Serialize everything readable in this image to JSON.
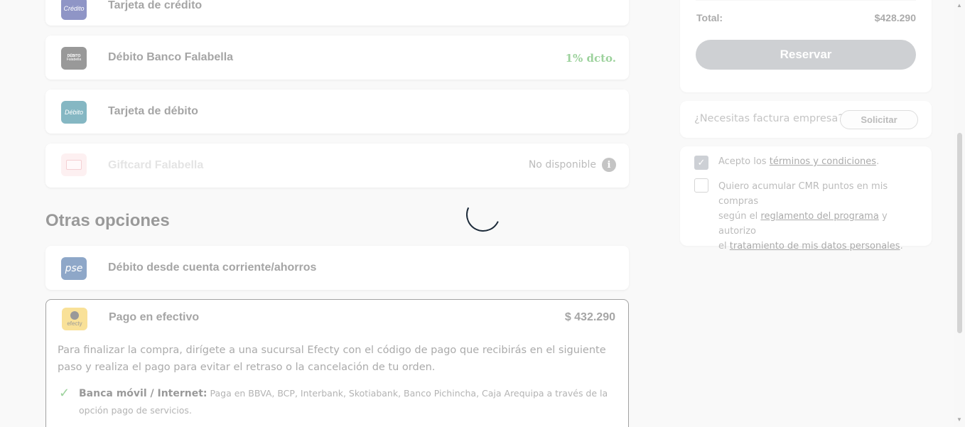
{
  "payment_methods": [
    {
      "label": "Tarjeta de crédito",
      "icon_text": "Crédito"
    },
    {
      "label": "Débito Banco Falabella",
      "icon_text_top": "DÉBITO",
      "icon_text_bottom": "Falabella",
      "badge": "1% dcto."
    },
    {
      "label": "Tarjeta de débito",
      "icon_text": "Débito"
    },
    {
      "label": "Giftcard Falabella",
      "status": "No disponible"
    }
  ],
  "other_options": {
    "title": "Otras opciones",
    "items": [
      {
        "label": "Débito desde cuenta corriente/ahorros",
        "icon_text": "pse"
      },
      {
        "label": "Pago en efectivo",
        "icon_text": "efecty",
        "price": "$ 432.290",
        "description": "Para finalizar la compra, dirígete a una sucursal Efecty con el código de pago que recibirás en el siguiente paso y realiza el pago para evitar el retraso o la cancelación de tu orden.",
        "bullet_title": "Banca móvil / Internet:",
        "bullet_text": "Paga en BBVA, BCP, Interbank, Skotiabank, Banco Pichincha, Caja Arequipa a través de la opción pago de servicios."
      }
    ]
  },
  "summary": {
    "total_label": "Total:",
    "total_value": "$428.290",
    "reserve_button": "Reservar"
  },
  "invoice": {
    "question": "¿Necesitas factura empresa?",
    "button": "Solicitar"
  },
  "terms": {
    "accept_prefix": "Acepto los ",
    "accept_link": "términos y condiciones",
    "accept_suffix": ".",
    "cmr_line1": "Quiero acumular CMR puntos en mis compras",
    "cmr_line2_prefix": "según el ",
    "cmr_link1": "reglamento del programa",
    "cmr_line2_suffix": " y autorizo",
    "cmr_line3_prefix": "el ",
    "cmr_link2": "tratamiento de mis datos personales",
    "cmr_line3_suffix": "."
  },
  "colors": {
    "discount_green": "#3aa53a",
    "credit_icon_bg": "#1f2a8c",
    "debito_falabella_icon_bg": "#333333",
    "debit_icon_bg": "#0b6e86",
    "pse_icon_bg": "#1d4f91",
    "efecty_icon_bg": "#f2c230",
    "reserve_button_bg": "#9ca0a6"
  }
}
